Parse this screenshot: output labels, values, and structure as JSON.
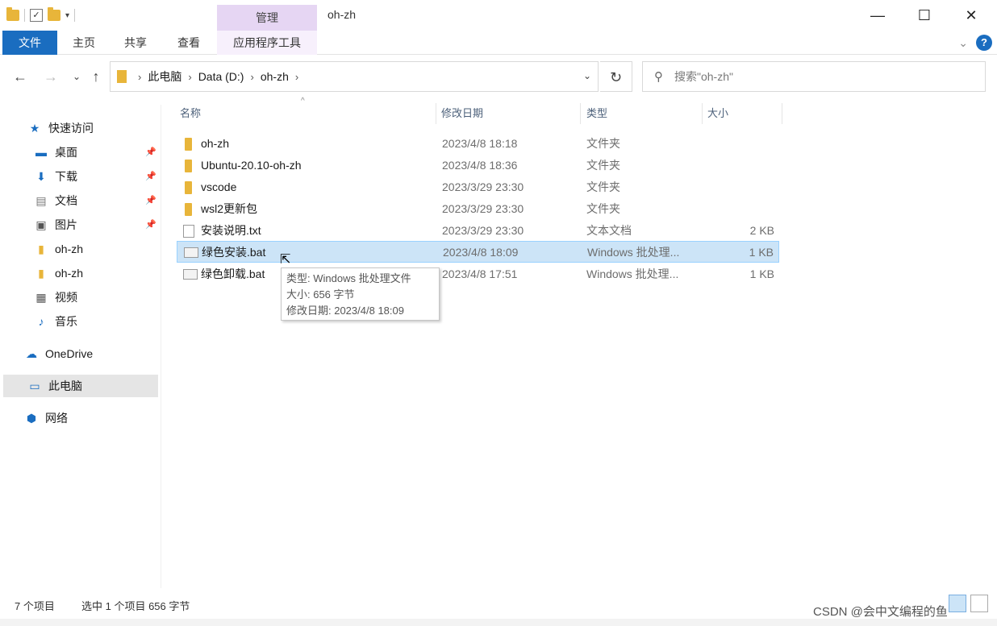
{
  "window": {
    "title": "oh-zh",
    "context_tab_group": "管理",
    "minimize": "—",
    "maximize": "☐",
    "close": "✕"
  },
  "ribbon": {
    "tabs": [
      "文件",
      "主页",
      "共享",
      "查看",
      "应用程序工具"
    ]
  },
  "address": {
    "breadcrumbs": [
      "此电脑",
      "Data (D:)",
      "oh-zh"
    ],
    "search_placeholder": "搜索\"oh-zh\""
  },
  "sidebar": {
    "items": [
      {
        "label": "快速访问",
        "icon": "star-icon"
      },
      {
        "label": "桌面",
        "icon": "desktop-icon",
        "pinned": true
      },
      {
        "label": "下载",
        "icon": "download-icon",
        "pinned": true
      },
      {
        "label": "文档",
        "icon": "document-icon",
        "pinned": true
      },
      {
        "label": "图片",
        "icon": "picture-icon",
        "pinned": true
      },
      {
        "label": "oh-zh",
        "icon": "folder-icon"
      },
      {
        "label": "oh-zh",
        "icon": "folder-icon"
      },
      {
        "label": "视频",
        "icon": "video-icon"
      },
      {
        "label": "音乐",
        "icon": "music-icon"
      },
      {
        "label": "OneDrive",
        "icon": "cloud-icon"
      },
      {
        "label": "此电脑",
        "icon": "computer-icon"
      },
      {
        "label": "网络",
        "icon": "network-icon"
      }
    ]
  },
  "columns": {
    "name": "名称",
    "date": "修改日期",
    "type": "类型",
    "size": "大小"
  },
  "files": [
    {
      "name": "oh-zh",
      "date": "2023/4/8 18:18",
      "type": "文件夹",
      "size": "",
      "icon": "folder-icon"
    },
    {
      "name": "Ubuntu-20.10-oh-zh",
      "date": "2023/4/8 18:36",
      "type": "文件夹",
      "size": "",
      "icon": "folder-icon"
    },
    {
      "name": "vscode",
      "date": "2023/3/29 23:30",
      "type": "文件夹",
      "size": "",
      "icon": "folder-icon"
    },
    {
      "name": "wsl2更新包",
      "date": "2023/3/29 23:30",
      "type": "文件夹",
      "size": "",
      "icon": "folder-icon"
    },
    {
      "name": "安装说明.txt",
      "date": "2023/3/29 23:30",
      "type": "文本文档",
      "size": "2 KB",
      "icon": "text-file-icon"
    },
    {
      "name": "绿色安装.bat",
      "date": "2023/4/8 18:09",
      "type": "Windows 批处理...",
      "size": "1 KB",
      "icon": "batch-file-icon"
    },
    {
      "name": "绿色卸载.bat",
      "date": "2023/4/8 17:51",
      "type": "Windows 批处理...",
      "size": "1 KB",
      "icon": "batch-file-icon"
    }
  ],
  "tooltip": {
    "line1": "类型: Windows 批处理文件",
    "line2": "大小: 656 字节",
    "line3": "修改日期: 2023/4/8 18:09"
  },
  "status": {
    "count": "7 个项目",
    "selection": "选中 1 个项目  656 字节"
  },
  "watermark": "CSDN @会中文编程的鱼"
}
